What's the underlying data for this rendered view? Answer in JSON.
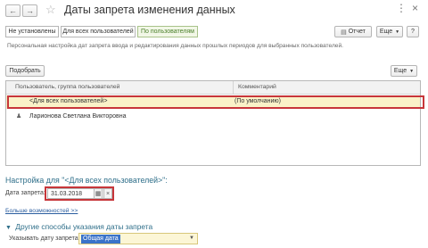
{
  "window": {
    "title": "Даты запрета изменения данных"
  },
  "filters": {
    "not_set": "Не установлены",
    "all_users": "Для всех пользователей",
    "by_users": "По пользователям"
  },
  "toolbar": {
    "report": "Отчет",
    "more": "Еще",
    "help": "?"
  },
  "description": "Персональная настройка дат запрета ввода и редактирования данных прошлых периодов для выбранных пользователей.",
  "table": {
    "pick_button": "Подобрать",
    "more": "Еще",
    "columns": {
      "user": "Пользователь, группа пользователей",
      "comment": "Комментарий"
    },
    "rows": [
      {
        "user": "<Для всех пользователей>",
        "comment": "(По умолчанию)"
      },
      {
        "user": "Ларионова Светлана Викторовна",
        "comment": ""
      }
    ]
  },
  "settings": {
    "title": "Настройка для \"<Для всех пользователей>\":",
    "date_label": "Дата запрета:",
    "date_value": "31.03.2018",
    "clear_symbol": "×",
    "more_link": "Больше возможностей >>",
    "other_methods_title": "Другие способы указания даты запрета",
    "specify_label": "Указывать дату запрета:",
    "specify_value": "Общая дата"
  }
}
